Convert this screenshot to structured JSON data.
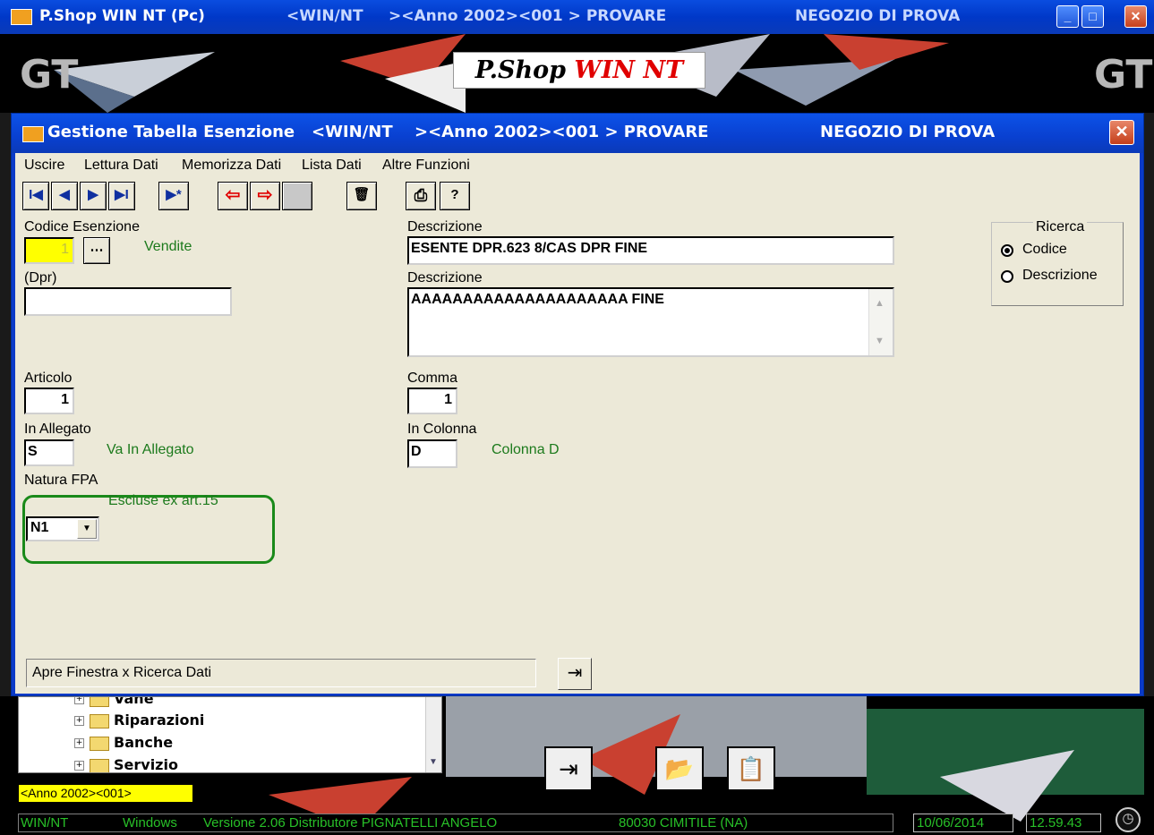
{
  "app": {
    "title": "P.Shop WIN NT (Pc)",
    "seg1": "<WIN/NT",
    "seg2": "><Anno 2002><001 > PROVARE",
    "store": "NEGOZIO DI PROVA",
    "min": "_",
    "max": "□",
    "close": "✕"
  },
  "banner": {
    "logo_prefix": "P.Shop ",
    "logo_suffix": "WIN NT",
    "gt_left": "GT",
    "gt_right": "GT"
  },
  "dialog": {
    "title": "Gestione Tabella Esenzione",
    "seg1": "<WIN/NT",
    "seg2": "><Anno 2002><001 > PROVARE",
    "store": "NEGOZIO DI PROVA",
    "close": "✕"
  },
  "menu": [
    "Uscire",
    "Lettura Dati",
    "Memorizza Dati",
    "Lista Dati",
    "Altre Funzioni"
  ],
  "toolbar": {
    "first": "I◀",
    "prev": "◀",
    "next": "▶",
    "last": "▶I",
    "new": "▶*",
    "undo": "⇦",
    "redo": "⇨",
    "blank": "",
    "delete": "🗑",
    "print": "⎙",
    "help": "?"
  },
  "form": {
    "codice_label": "Codice Esenzione",
    "codice_value": "1",
    "codice_lookup": "⋯",
    "vendite": "Vendite",
    "dpr_label": "(Dpr)",
    "dpr_value": "",
    "desc1_label": "Descrizione",
    "desc1_value": "ESENTE DPR.623 8/CAS DPR  FINE",
    "desc2_label": "Descrizione",
    "desc2_value": "AAAAAAAAAAAAAAAAAAAAA FINE",
    "articolo_label": "Articolo",
    "articolo_value": "1",
    "comma_label": "Comma",
    "comma_value": "1",
    "allegato_label": "In Allegato",
    "allegato_value": "S",
    "allegato_desc": "Va In Allegato",
    "colonna_label": "In Colonna",
    "colonna_value": "D",
    "colonna_desc": "Colonna D",
    "natura_label": "Natura FPA",
    "natura_value": "N1",
    "natura_desc": "Escluse ex art.15"
  },
  "ricerca": {
    "title": "Ricerca",
    "opt_codice": "Codice",
    "opt_descrizione": "Descrizione",
    "selected": "Codice"
  },
  "hint": "Apre Finestra x Ricerca Dati",
  "tree": {
    "items": [
      "Vane",
      "Riparazioni",
      "Banche",
      "Servizio"
    ]
  },
  "status": {
    "anno": "<Anno 2002><001>",
    "winnt": "WIN/NT",
    "windows": "Windows",
    "version": "Versione 2.06 Distributore PIGNATELLI ANGELO",
    "location": "80030 CIMITILE (NA)",
    "date": "10/06/2014",
    "time": "12.59.43"
  },
  "colors": {
    "title_blue": "#0a3ac8",
    "form_bg": "#ece9d8",
    "green_text": "#1c7a1c",
    "status_yellow": "#ffff00",
    "status_green": "#28c028",
    "close_red": "#c8401c"
  }
}
